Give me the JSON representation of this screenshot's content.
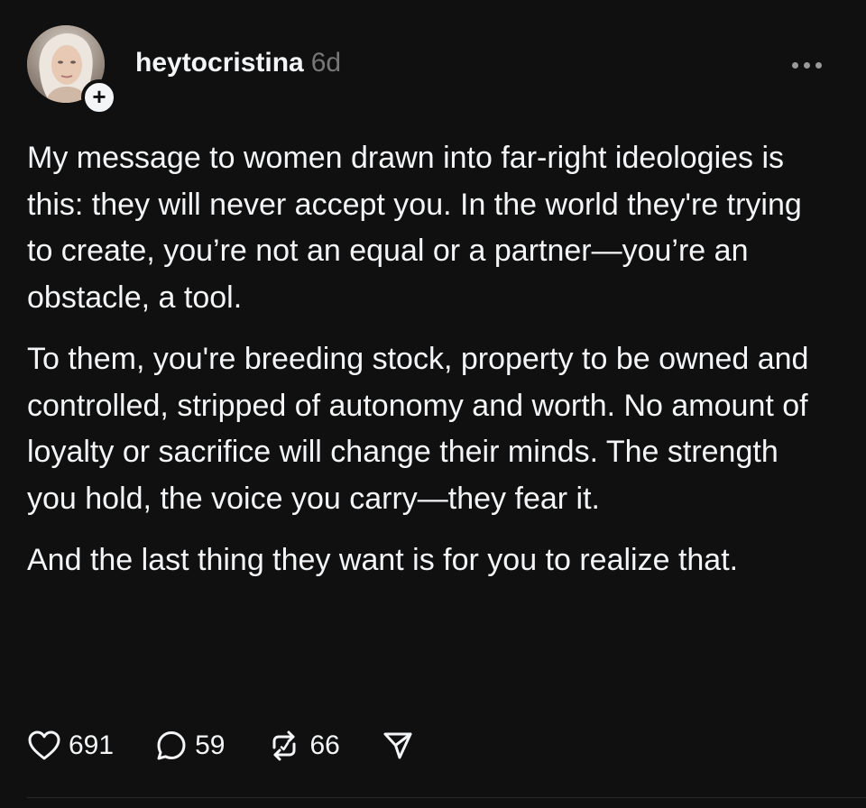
{
  "post": {
    "author": {
      "username": "heytocristina",
      "time_ago": "6d",
      "follow_badge": "+"
    },
    "paragraphs": [
      "My message to women drawn into far-right ideologies is this: they will never accept you. In the world they're trying to create, you’re not an equal or a partner—you’re an obstacle, a tool.",
      "To them, you're breeding stock, property to be owned and controlled, stripped of autonomy and worth. No amount of loyalty or sacrifice will change their minds. The strength you hold, the voice you carry—they fear it.",
      "And the last thing they want is for you to realize that."
    ],
    "actions": {
      "likes": "691",
      "replies": "59",
      "reposts": "66"
    },
    "icons": {
      "like": "heart-icon",
      "reply": "comment-bubble-icon",
      "repost": "repost-arrows-icon",
      "share": "send-icon",
      "more": "more-dots-icon"
    },
    "colors": {
      "background": "#101010",
      "text": "#f3f5f7",
      "muted": "#777777"
    }
  }
}
